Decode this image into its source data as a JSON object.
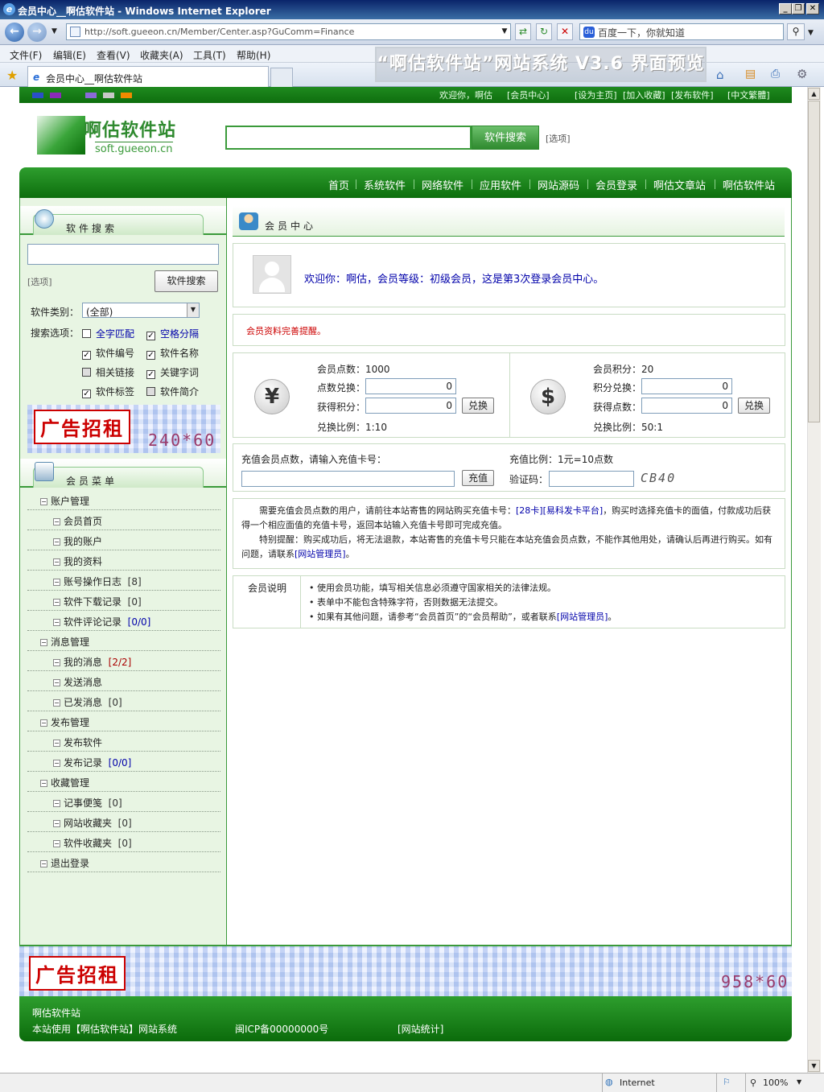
{
  "browser": {
    "window_title": "会员中心__啊估软件站 - Windows Internet Explorer",
    "url": "http://soft.gueeon.cn/Member/Center.asp?GuComm=Finance",
    "search_placeholder": "百度一下，你就知道",
    "menu": [
      "文件(F)",
      "编辑(E)",
      "查看(V)",
      "收藏夹(A)",
      "工具(T)",
      "帮助(H)"
    ],
    "watermark": "“啊估软件站”网站系统 V3.6 界面预览",
    "tab_title": "会员中心__啊估软件站",
    "status_zone": "Internet",
    "zoom": "100%"
  },
  "site": {
    "topbar_greeting": "欢迎你，啊估",
    "topbar_links": [
      "[会员中心]",
      "[设为主页]",
      "[加入收藏]",
      "[发布软件]",
      "[中文繁體]"
    ],
    "logo_name": "啊估软件站",
    "logo_url": "soft.gueeon.cn",
    "search_button": "软件搜索",
    "search_option": "[选项]",
    "nav": [
      "首页",
      "系统软件",
      "网络软件",
      "应用软件",
      "网站源码",
      "会员登录",
      "啊估文章站",
      "啊估软件站"
    ],
    "colors": {
      "brand_green": "#2e9e2e",
      "alert_red": "#cc0000",
      "link_blue": "#0000aa"
    }
  },
  "sidebar": {
    "search_title": "软件搜索",
    "search_option": "[选项]",
    "search_button": "软件搜索",
    "category_label": "软件类别：",
    "category_value": "(全部)",
    "options_label": "搜索选项：",
    "options": [
      {
        "label": "全字匹配",
        "checked": false
      },
      {
        "label": "空格分隔",
        "checked": true
      },
      {
        "label": "软件编号",
        "checked": true
      },
      {
        "label": "软件名称",
        "checked": true
      },
      {
        "label": "相关链接",
        "checked": false
      },
      {
        "label": "关键字词",
        "checked": true
      },
      {
        "label": "软件标签",
        "checked": true
      },
      {
        "label": "软件简介",
        "checked": false
      }
    ],
    "ad_text": "广告招租",
    "ad_size": "240*60",
    "menu_title": "会员菜单",
    "menu": [
      {
        "type": "group",
        "label": "账户管理"
      },
      {
        "type": "item",
        "label": "会员首页"
      },
      {
        "type": "item",
        "label": "我的账户"
      },
      {
        "type": "item",
        "label": "我的资料"
      },
      {
        "type": "item",
        "label": "账号操作日志",
        "count": "[8]"
      },
      {
        "type": "item",
        "label": "软件下载记录",
        "count": "[0]"
      },
      {
        "type": "item",
        "label": "软件评论记录",
        "count": "[0/0]"
      },
      {
        "type": "group",
        "label": "消息管理"
      },
      {
        "type": "item",
        "label": "我的消息",
        "count": "[2/2]"
      },
      {
        "type": "item",
        "label": "发送消息"
      },
      {
        "type": "item",
        "label": "已发消息",
        "count": "[0]"
      },
      {
        "type": "group",
        "label": "发布管理"
      },
      {
        "type": "item",
        "label": "发布软件"
      },
      {
        "type": "item",
        "label": "发布记录",
        "count": "[0/0]"
      },
      {
        "type": "group",
        "label": "收藏管理"
      },
      {
        "type": "item",
        "label": "记事便笺",
        "count": "[0]"
      },
      {
        "type": "item",
        "label": "网站收藏夹",
        "count": "[0]"
      },
      {
        "type": "item",
        "label": "软件收藏夹",
        "count": "[0]"
      },
      {
        "type": "group",
        "label": "退出登录"
      }
    ]
  },
  "main": {
    "title": "会员中心",
    "welcome": "欢迎你：啊估，会员等级：初级会员，这是第3次登录会员中心。",
    "alert": "会员资料完善提醒。",
    "points": {
      "label": "会员点数：",
      "value": "1000",
      "exchange_label": "点数兑换：",
      "exchange_value": "0",
      "gain_label": "获得积分：",
      "gain_value": "0",
      "button": "兑换",
      "ratio": "兑换比例：1:10"
    },
    "score": {
      "label": "会员积分：",
      "value": "20",
      "exchange_label": "积分兑换：",
      "exchange_value": "0",
      "gain_label": "获得点数：",
      "gain_value": "0",
      "button": "兑换",
      "ratio": "兑换比例：50:1"
    },
    "recharge": {
      "prompt": "充值会员点数，请输入充值卡号：",
      "button": "充值",
      "ratio": "充值比例：1元=10点数",
      "captcha_label": "验证码：",
      "captcha": "CB40"
    },
    "notice": {
      "p1_a": "需要充值会员点数的用户，请前往本站寄售的网站购买充值卡号：",
      "link1": "[28卡]",
      "link2": "[易科发卡平台]",
      "p1_b": "，购买时选择充值卡的面值，付款成功后获得一个相应面值的充值卡号，返回本站输入充值卡号即可完成充值。",
      "p2_a": "特别提醒：购买成功后，将无法退款，本站寄售的充值卡号只能在本站充值会员点数，不能作其他用处，请确认后再进行购买。如有问题，请联系",
      "link3": "[网站管理员]",
      "p2_b": "。"
    },
    "info": {
      "label": "会员说明",
      "lines": [
        "• 使用会员功能，填写相关信息必须遵守国家相关的法律法规。",
        "• 表单中不能包含特殊字符，否则数据无法提交。",
        "• 如果有其他问题，请参考“会员首页”的“会员帮助”，或者联系"
      ],
      "link": "[网站管理员]",
      "tail": "。"
    }
  },
  "footer": {
    "ad_text": "广告招租",
    "ad_size": "958*60",
    "site_name": "啊估软件站",
    "powered": "本站使用【啊估软件站】网站系统",
    "icp": "闽ICP备00000000号",
    "stats": "[网站统计]"
  }
}
